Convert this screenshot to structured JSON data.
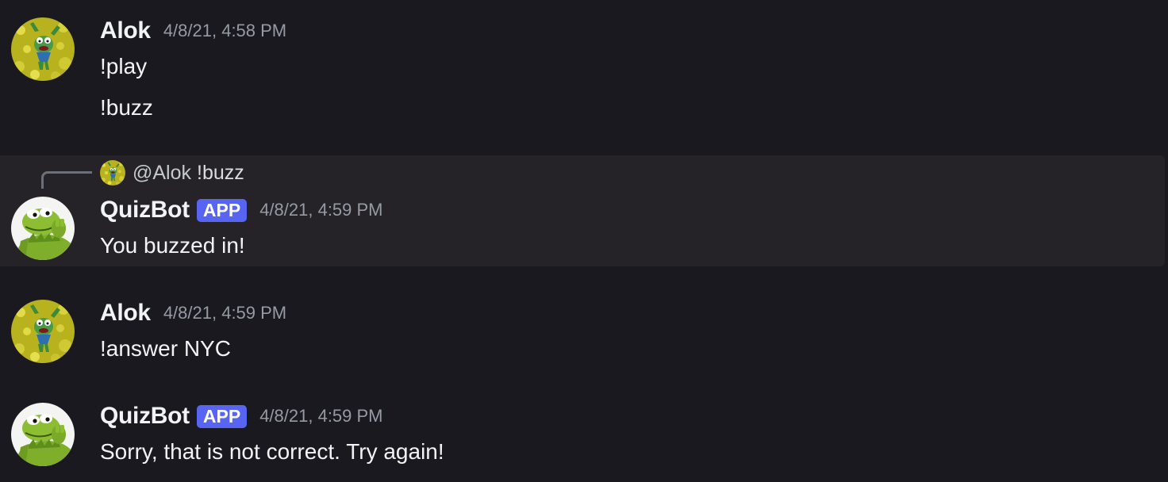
{
  "messages": [
    {
      "author": "Alok",
      "timestamp": "4/8/21, 4:58 PM",
      "avatar_icon": "kermit-in-flowers-avatar",
      "lines": [
        "!play",
        "!buzz"
      ]
    },
    {
      "reply_to": {
        "mention": "@Alok",
        "content": "!buzz"
      },
      "author": "QuizBot",
      "badge": "APP",
      "timestamp": "4/8/21, 4:59 PM",
      "avatar_icon": "kermit-avatar",
      "lines": [
        "You buzzed in!"
      ]
    },
    {
      "author": "Alok",
      "timestamp": "4/8/21, 4:59 PM",
      "avatar_icon": "kermit-in-flowers-avatar",
      "lines": [
        "!answer NYC"
      ]
    },
    {
      "author": "QuizBot",
      "badge": "APP",
      "timestamp": "4/8/21, 4:59 PM",
      "avatar_icon": "kermit-avatar",
      "lines": [
        "Sorry, that is not correct. Try again!"
      ]
    }
  ],
  "colors": {
    "background": "#1a191f",
    "highlight": "#252328",
    "app_badge": "#5865f2",
    "timestamp": "#949ba4",
    "username": "#f2f3f5"
  }
}
